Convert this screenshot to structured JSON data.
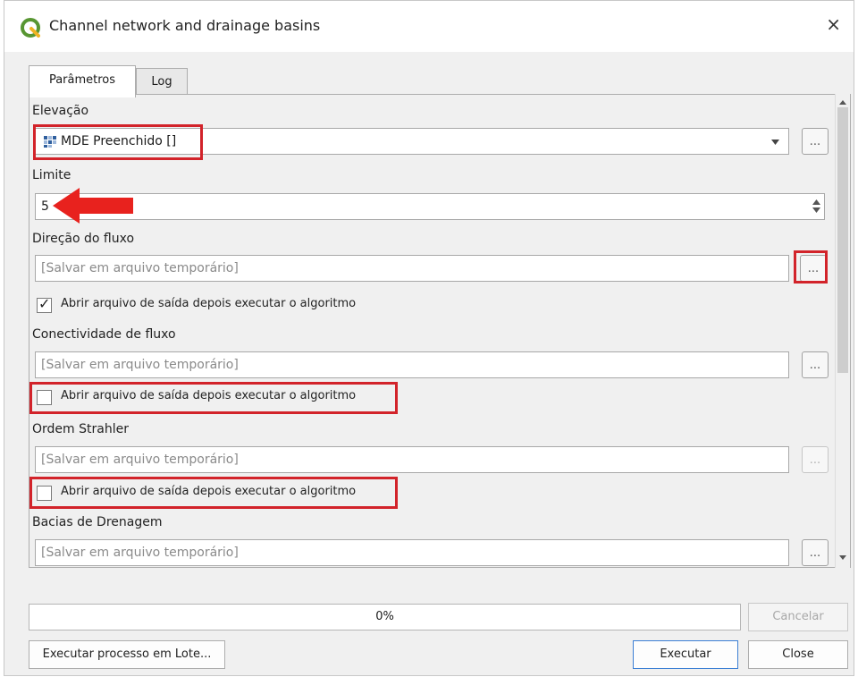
{
  "window": {
    "title": "Channel network and drainage basins",
    "close_glyph": "×"
  },
  "tabs": [
    {
      "label": "Parâmetros"
    },
    {
      "label": "Log"
    }
  ],
  "params": {
    "elevacao": {
      "label": "Elevação",
      "value": "MDE Preenchido []",
      "dots": "..."
    },
    "limite": {
      "label": "Limite",
      "value": "5"
    },
    "direcao": {
      "label": "Direção do fluxo",
      "placeholder": "[Salvar em arquivo temporário]",
      "dots": "...",
      "checkbox": "Abrir arquivo de saída depois executar o algoritmo",
      "checked": true
    },
    "conectividade": {
      "label": "Conectividade de fluxo",
      "placeholder": "[Salvar em arquivo temporário]",
      "dots": "...",
      "checkbox": "Abrir arquivo de saída depois executar o algoritmo",
      "checked": false
    },
    "strahler": {
      "label": "Ordem Strahler",
      "placeholder": "[Salvar em arquivo temporário]",
      "dots": "...",
      "checkbox": "Abrir arquivo de saída depois executar o algoritmo",
      "checked": false
    },
    "bacias": {
      "label": "Bacias de Drenagem",
      "placeholder": "[Salvar em arquivo temporário]",
      "dots": "..."
    }
  },
  "progress": {
    "text": "0%",
    "value": 0
  },
  "buttons": {
    "cancel": "Cancelar",
    "batch": "Executar processo em Lote...",
    "run": "Executar",
    "close": "Close"
  },
  "colors": {
    "highlight": "#d2232a",
    "arrow": "#e8221e",
    "qgis_green": "#589632"
  },
  "icons": {
    "app": "qgis-logo-icon",
    "raster": "raster-layer-icon",
    "dropdown": "chevron-down-icon",
    "spin": "spinbox-arrows-icon",
    "scroll_up": "scroll-up-icon",
    "scroll_down": "scroll-down-icon"
  }
}
